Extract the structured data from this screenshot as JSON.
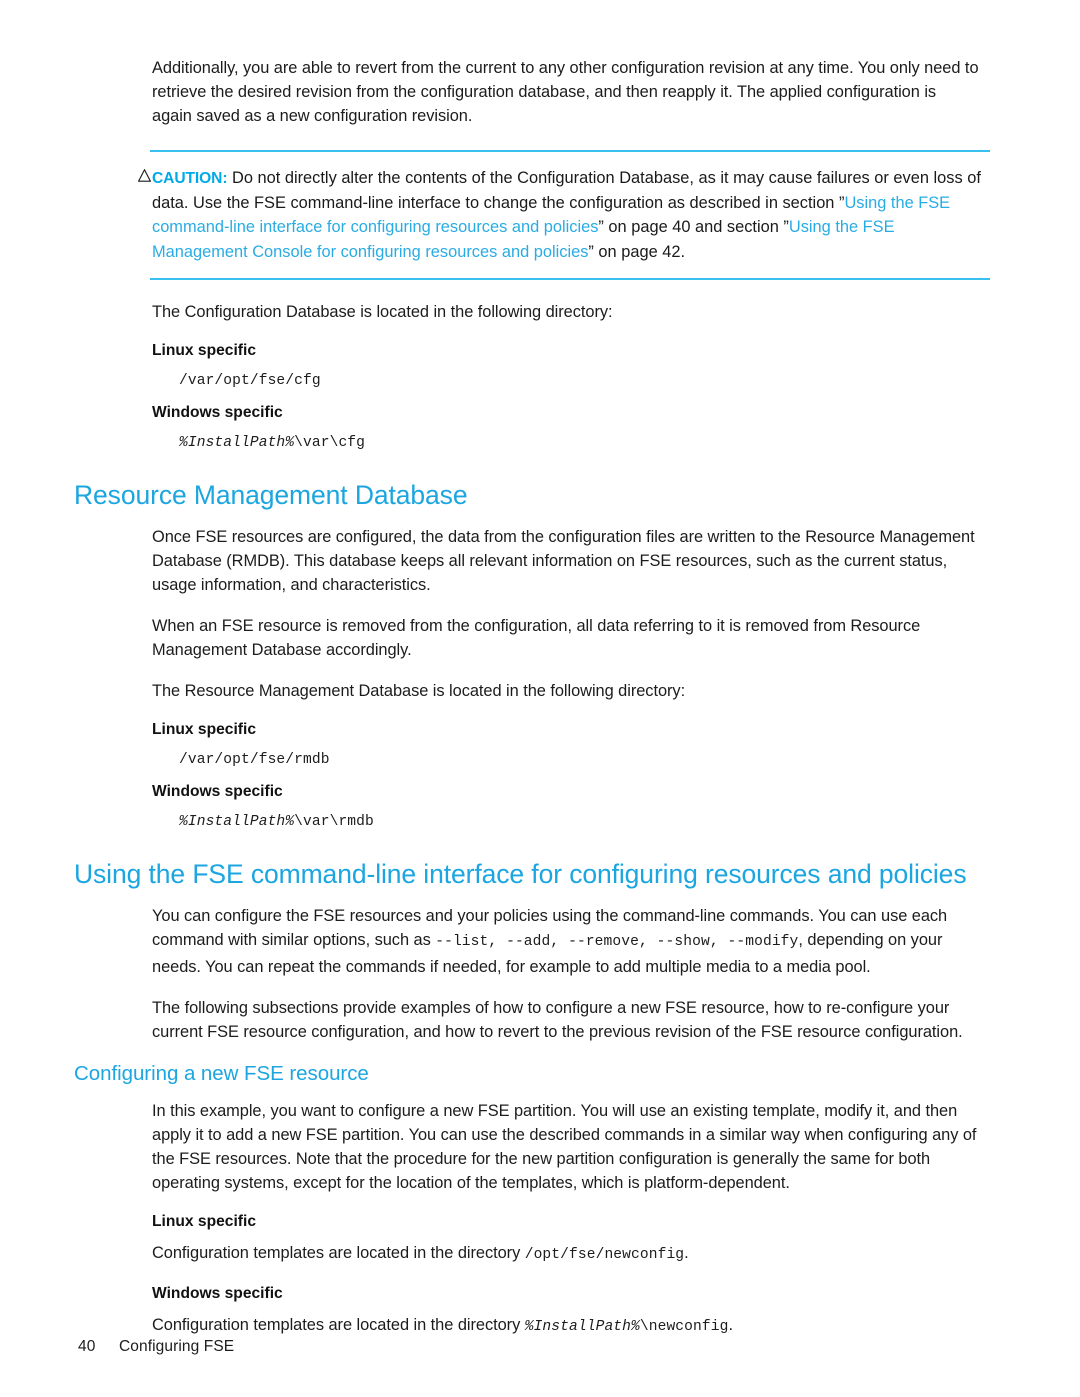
{
  "page": {
    "number": "40",
    "running_title": "Configuring FSE"
  },
  "intro": {
    "paragraph": "Additionally, you are able to revert from the current to any other configuration revision at any time. You only need to retrieve the desired revision from the configuration database, and then reapply it. The applied configuration is again saved as a new configuration revision."
  },
  "caution": {
    "label": "CAUTION:",
    "text_before_first_xref": "Do not directly alter the contents of the Configuration Database, as it may cause failures or even loss of data. Use the FSE command-line interface to change the configuration as described in section ”",
    "xref1": "Using the FSE command-line interface for configuring resources and policies",
    "text_between": "” on page 40 and section ”",
    "xref2": "Using the FSE Management Console for configuring resources and policies",
    "text_after": "” on page 42."
  },
  "config_db": {
    "intro": "The Configuration Database is located in the following directory:",
    "linux_label": "Linux specific",
    "linux_path": "/var/opt/fse/cfg",
    "windows_label": "Windows specific",
    "windows_path_var": "%InstallPath%",
    "windows_path_rest": "\\var\\cfg"
  },
  "rmdb": {
    "heading": "Resource Management Database",
    "paragraph1": "Once FSE resources are configured, the data from the configuration files are written to the Resource Management Database (RMDB). This database keeps all relevant information on FSE resources, such as the current status, usage information, and characteristics.",
    "paragraph2": "When an FSE resource is removed from the configuration, all data referring to it is removed from Resource Management Database accordingly.",
    "paragraph3": "The Resource Management Database is located in the following directory:",
    "linux_label": "Linux specific",
    "linux_path": "/var/opt/fse/rmdb",
    "windows_label": "Windows specific",
    "windows_path_var": "%InstallPath%",
    "windows_path_rest": "\\var\\rmdb"
  },
  "cli_section": {
    "heading": "Using the FSE command-line interface for configuring resources and policies",
    "para1_part1": "You can configure the FSE resources and your policies using the command-line commands. You can use each command with similar options, such as ",
    "para1_options": "--list, --add, --remove, --show, --modify",
    "para1_part2": ", depending on your needs. You can repeat the commands if needed, for example to add multiple media to a media pool.",
    "para2": "The following subsections provide examples of how to configure a new FSE resource, how to re-configure your current FSE resource configuration, and how to revert to the previous revision of the FSE resource configuration."
  },
  "new_resource": {
    "heading": "Configuring a new FSE resource",
    "paragraph": "In this example, you want to configure a new FSE partition. You will use an existing template, modify it, and then apply it to add a new FSE partition. You can use the described commands in a similar way when configuring any of the FSE resources. Note that the procedure for the new partition configuration is generally the same for both operating systems, except for the location of the templates, which is platform-dependent.",
    "linux_label": "Linux specific",
    "linux_sentence_before": "Configuration templates are located in the directory ",
    "linux_path": "/opt/fse/newconfig",
    "linux_sentence_after": ".",
    "windows_label": "Windows specific",
    "windows_sentence_before": "Configuration templates are located in the directory ",
    "windows_path_var": "%InstallPath%",
    "windows_path_rest": "\\newconfig",
    "windows_sentence_after": "."
  },
  "colors": {
    "heading_blue": "#1ca6e0",
    "caution_blue": "#00a9e8",
    "rule_blue": "#38c0ef",
    "xref_blue": "#29ace3",
    "text": "#1c1c1c"
  }
}
